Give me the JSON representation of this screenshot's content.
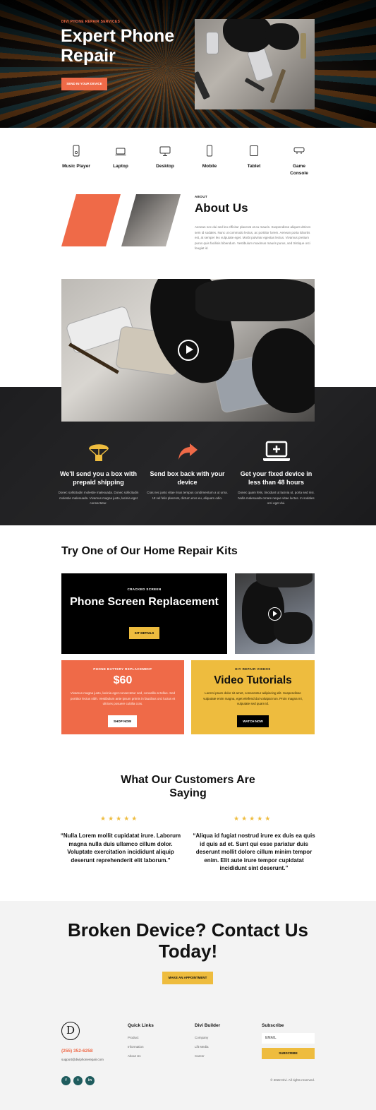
{
  "hero": {
    "eyebrow": "DIVI PHONE REPAIR SERVICES",
    "title": "Expert Phone Repair",
    "button": "SEND IN YOUR DEVICE"
  },
  "devices": [
    {
      "label": "Music Player",
      "icon": "music-player-icon"
    },
    {
      "label": "Laptop",
      "icon": "laptop-icon"
    },
    {
      "label": "Desktop",
      "icon": "desktop-icon"
    },
    {
      "label": "Mobile",
      "icon": "mobile-icon"
    },
    {
      "label": "Tablet",
      "icon": "tablet-icon"
    },
    {
      "label": "Game Console",
      "icon": "game-console-icon"
    }
  ],
  "about": {
    "eyebrow": "ABOUT",
    "title": "About Us",
    "text": "Aenean nec dui sed leo efficitur placerat ut eu mauris. Suspendisse aliquet ultrices sem id sodales. Nunc ut commodo lectus, ac porttitor lorem. Aenean porta lobortis est, at semper leo vulputate eget. Morbi pulvinar egestas lectus. Vivamus pretium purus quis facilisis bibendum. Vestibulum maximus mauris purus, sed tristique orci feugiat id."
  },
  "video": {
    "play_icon": "play-icon"
  },
  "steps": [
    {
      "icon": "parachute-box-icon",
      "color": "#eebc3e",
      "title": "We'll send you a box with prepaid shipping",
      "text": "Donec sollicitudin molestie malesuada. Donec sollicitudin molestie malesuada. Vivamus magna justo, lacinia eget consectetur."
    },
    {
      "icon": "share-arrow-icon",
      "color": "#ef6a48",
      "title": "Send box back with your device",
      "text": "Cras nec justo vitae risus tempus condimentum a ut urna. Ut vel felis placerat, dictum eros eu, aliquam odio."
    },
    {
      "icon": "laptop-medical-icon",
      "color": "#ffffff",
      "title": "Get your fixed device in less than 48 hours",
      "text": "Donec quam felis, tincidunt ut lacinia ut, porta sed nisi. Nulla malesuada ornare neque vitae luctus. In sodales orci eget dui."
    }
  ],
  "kits": {
    "title": "Try One of Our Home Repair Kits",
    "screen": {
      "eyebrow": "CRACKED SCREEN",
      "title": "Phone Screen Replacement",
      "button": "KIT DETAILS"
    },
    "battery": {
      "eyebrow": "PHONE BATTERY REPLACEMENT",
      "price": "$60",
      "text": "Vivamus magna justo, lacinia eget consectetur sed, convallis at tellus. Sed porttitor lectus nibh. Vestibulum ante ipsum primis in faucibus orci luctus et ultrices posuere cubilia cras.",
      "button": "SHOP NOW"
    },
    "videos": {
      "eyebrow": "DIY REPAIR VIDEOS",
      "title": "Video Tutorials",
      "text": "Lorem ipsum dolor sit amet, consectetur adipiscing elit. Suspendisse vulputate enim magna, eget eleifend dui volutpat non. Proin magna mi, vulputate sed quam id.",
      "button": "WATCH NOW"
    }
  },
  "testimonials": {
    "title": "What Our Customers Are Saying",
    "stars": "★★★★★",
    "rating": 5,
    "items": [
      {
        "quote": "“Nulla Lorem mollit cupidatat irure. Laborum magna nulla duis ullamco cillum dolor. Voluptate exercitation incididunt aliquip deserunt reprehenderit elit laborum.”"
      },
      {
        "quote": "“Aliqua id fugiat nostrud irure ex duis ea quis id quis ad et. Sunt qui esse pariatur duis deserunt mollit dolore cillum minim tempor enim. Elit aute irure tempor cupidatat incididunt sint deserunt.”"
      }
    ]
  },
  "cta": {
    "title": "Broken Device? Contact Us Today!",
    "button": "MAKE AN APPOINTMENT"
  },
  "footer": {
    "logo": "D",
    "phone": "(255) 352-6258",
    "email": "support@diviphonerepair.com",
    "quick_links": {
      "title": "Quick Links",
      "items": [
        "Product",
        "Information",
        "About Us"
      ]
    },
    "divi_builder": {
      "title": "Divi Builder",
      "items": [
        "Company",
        "Lift Media",
        "Career"
      ]
    },
    "subscribe": {
      "title": "Subscribe",
      "placeholder": "EMAIL",
      "button": "SUBSCRIBE"
    },
    "social": [
      {
        "icon": "facebook-icon",
        "glyph": "f"
      },
      {
        "icon": "twitter-icon",
        "glyph": "t"
      },
      {
        "icon": "linkedin-icon",
        "glyph": "in"
      }
    ],
    "copyright": "© 2022 Divi. All rights reserved."
  },
  "colors": {
    "accent_orange": "#ef6a48",
    "accent_yellow": "#eebc3e",
    "social_teal": "#1f5c5e"
  }
}
